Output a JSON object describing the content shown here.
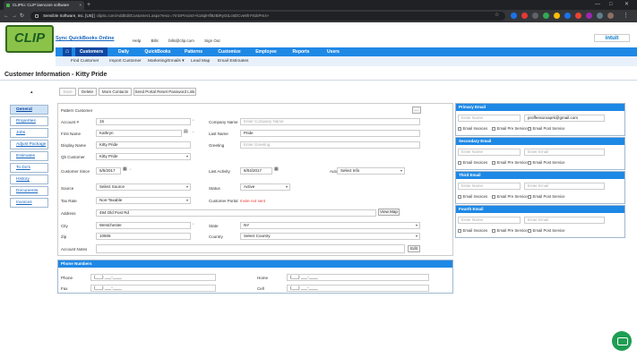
{
  "browser": {
    "tab_title": "CLIPto: CLIP laencare software",
    "url_host": "Sensible Software, Inc. [US] | ",
    "url_path": "clipitc.com/AddEditCustomer1.aspx?encr=7mGPmcis0+k18qlHfl8zBiRyGtLc6DCve8hY91kPm4+",
    "new_tab": "+",
    "close_tab": "×"
  },
  "app": {
    "logo_text": "CLIP",
    "sync_link": "Sync QuickBooks Online",
    "top_links": [
      "Help",
      "Bills",
      "bills@clip.com",
      "Sign Out"
    ],
    "intuit": "intuit",
    "main_nav": [
      "Customers",
      "Daily",
      "QuickBooks",
      "Patterns",
      "Customize",
      "Employee",
      "Reports",
      "Users"
    ],
    "sub_nav": [
      "Find Customer",
      "Import Customer",
      "Marketing/Emails ▾",
      "Lead Map",
      "Email Estimates"
    ]
  },
  "page": {
    "title": "Customer Information - Kitty Pride",
    "collapse": "▴"
  },
  "side_nav": [
    "General",
    "Properties",
    "Jobs",
    "Adjust Package",
    "Estimates",
    "To Do's",
    "History",
    "Documents",
    "Invoices"
  ],
  "toolbar": [
    "Save",
    "Delete",
    "More Contacts",
    "Send Portal Reset Password Link"
  ],
  "form": {
    "pattern_customer_label": "Pattern Customer",
    "pattern_btn": "...",
    "account_label": "Account #",
    "account_value": "15",
    "company_label": "Company Name",
    "company_ph": "Enter Company Name",
    "first_label": "First Name",
    "first_value": "Kathryn",
    "last_label": "Last Name",
    "last_value": "Pride",
    "display_label": "Display Name",
    "display_value": "Kitty Pride",
    "greeting_label": "Greeting",
    "greeting_ph": "Enter Greeting",
    "qb_label": "Qb Customer",
    "qb_value": "Kitty Pride",
    "since_label": "Customer Since",
    "since_value": "5/5/2017",
    "activity_label": "Last Activity",
    "activity_value": "8/04/2017",
    "autopay_label": "Auto Pay",
    "autopay_value": "Select Info",
    "source_label": "Source",
    "source_value": "Select Source",
    "status_label": "Status",
    "status_value": "Active",
    "tax_label": "Tax Rate",
    "tax_value": "Non-Taxable",
    "portal_label": "Customer Portal",
    "portal_value": "Invite not sent",
    "address_label": "Address",
    "address_value": "494 Old Post Rd",
    "viewmap": "View Map",
    "city_label": "City",
    "city_value": "Westchester",
    "state_label": "State",
    "state_value": "NY",
    "zip_label": "Zip",
    "zip_value": "10506",
    "country_label": "Country",
    "country_value": "Select Country",
    "notes_label": "Account Notes",
    "edit_btn": "Edit",
    "req": "*"
  },
  "phones": {
    "header": "Phone Numbers",
    "phone_label": "Phone",
    "home_label": "Home",
    "fax_label": "Fax",
    "cell_label": "Cell",
    "mask": "(___) ___-____"
  },
  "emails": [
    {
      "header": "Primary Email",
      "name_ph": "Enter Name",
      "email_value": "proffessorxaprk@gmail.com",
      "email_ph": ""
    },
    {
      "header": "Secondary Email",
      "name_ph": "Enter Name",
      "email_value": "",
      "email_ph": "Enter Email"
    },
    {
      "header": "Third Email",
      "name_ph": "Enter Name",
      "email_value": "",
      "email_ph": "Enter Email"
    },
    {
      "header": "Fourth Email",
      "name_ph": "Enter Name",
      "email_value": "",
      "email_ph": "Enter Email"
    }
  ],
  "email_checks": [
    "Email Invoices",
    "Email Pre Service",
    "Email Post Service"
  ],
  "colors": {
    "nav_blue": "#1e88e5",
    "nav_dark": "#0d47a1",
    "logo_green": "#8bc34a",
    "chat_green": "#1e9e52",
    "portal_red": "#e53935"
  }
}
